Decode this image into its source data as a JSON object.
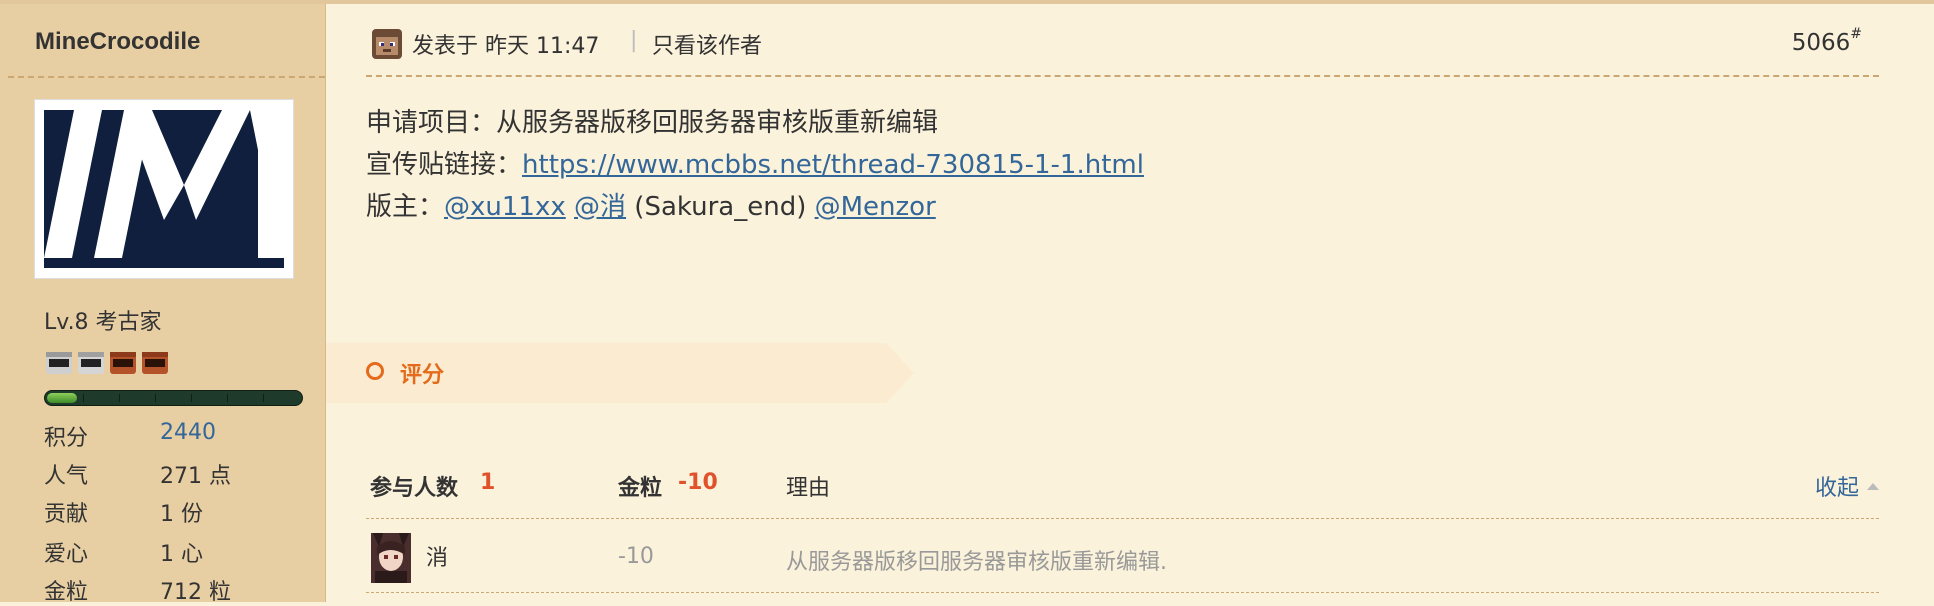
{
  "author": {
    "username": "MineCrocodile",
    "level": "Lv.8 考古家",
    "exp_progress": 0.12,
    "stats": [
      {
        "label": "积分",
        "value": "2440",
        "link": true
      },
      {
        "label": "人气",
        "value": "271 点",
        "link": false
      },
      {
        "label": "贡献",
        "value": "1 份",
        "link": false
      },
      {
        "label": "爱心",
        "value": "1 心",
        "link": false
      },
      {
        "label": "金粒",
        "value": "712 粒",
        "link": false
      }
    ]
  },
  "post": {
    "posted_at": "发表于 昨天 11:47",
    "author_only": "只看该作者",
    "floor_number": "5066",
    "floor_suffix": "#",
    "line1": "申请项目：从服务器版移回服务器审核版重新编辑",
    "line2_label": "宣传贴链接：",
    "line2_link": "https://www.mcbbs.net/thread-730815-1-1.html",
    "line3_label": "版主：",
    "moderator1": "@xu11xx",
    "moderator2": "@消",
    "moderator2_note": " (Sakura_end) ",
    "moderator3": "@Menzor"
  },
  "rating": {
    "title": "评分",
    "participants_label": "参与人数",
    "participants_count": "1",
    "coin_label": "金粒",
    "coin_total": "-10",
    "reason_label": "理由",
    "collapse_label": "收起",
    "rows": [
      {
        "user": "消",
        "amount": "-10",
        "reason": "从服务器版移回服务器审核版重新编辑."
      }
    ]
  },
  "colors": {
    "background": "#fbf2db",
    "sidebar": "#e8cfa3",
    "link": "#336699",
    "accent": "#e36b1b",
    "negative": "#e0522c"
  }
}
